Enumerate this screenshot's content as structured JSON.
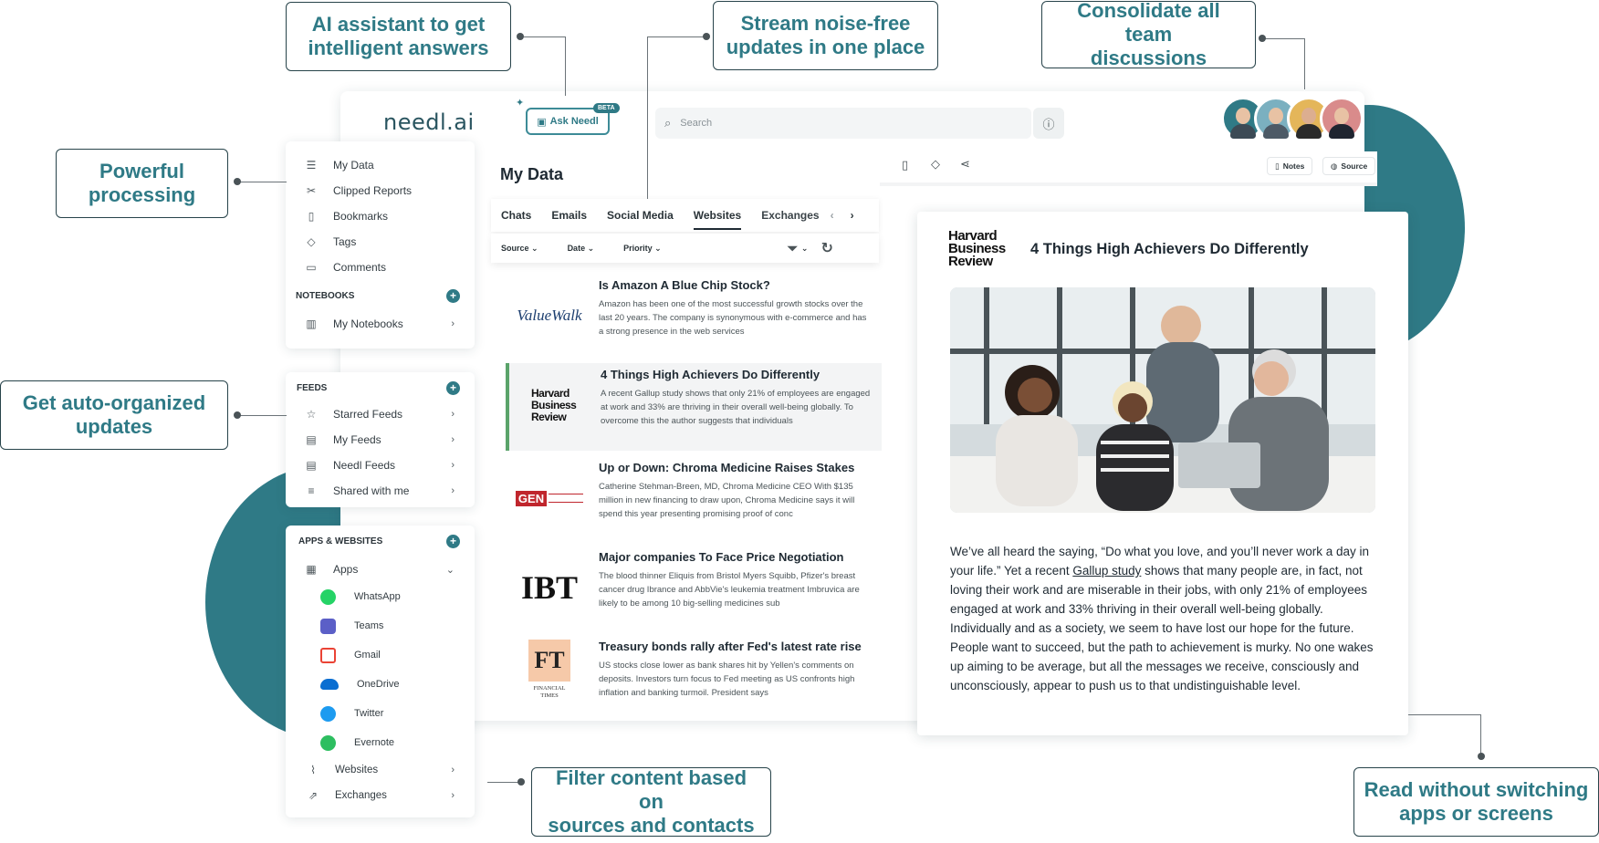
{
  "callouts": {
    "ai": "AI assistant to get\nintelligent answers",
    "stream": "Stream noise-free\nupdates in one place",
    "consolidate": "Consolidate all team\ndiscussions",
    "processing": "Powerful\nprocessing",
    "auto": "Get auto-organized\nupdates",
    "filter": "Filter content based on\nsources and contacts",
    "read": "Read without switching\napps or screens"
  },
  "header": {
    "logo": "needl.ai",
    "ask_label": "Ask Needl",
    "beta": "BETA",
    "search_placeholder": "Search"
  },
  "sidebar": {
    "main_items": [
      {
        "label": "My Data",
        "icon": "list-icon"
      },
      {
        "label": "Clipped Reports",
        "icon": "scissors-icon"
      },
      {
        "label": "Bookmarks",
        "icon": "bookmark-icon"
      },
      {
        "label": "Tags",
        "icon": "tag-icon"
      },
      {
        "label": "Comments",
        "icon": "comment-icon"
      }
    ],
    "notebooks_heading": "NOTEBOOKS",
    "notebooks_item": "My Notebooks",
    "feeds_heading": "FEEDS",
    "feeds": [
      "Starred Feeds",
      "My Feeds",
      "Needl Feeds",
      "Shared with me"
    ],
    "apps_heading": "APPS & WEBSITES",
    "apps_label": "Apps",
    "apps": [
      {
        "label": "WhatsApp",
        "color": "#25d366"
      },
      {
        "label": "Teams",
        "color": "#5b5fc7"
      },
      {
        "label": "Gmail",
        "color": "#ea4335"
      },
      {
        "label": "OneDrive",
        "color": "#0a6ed1"
      },
      {
        "label": "Twitter",
        "color": "#1d9bf0"
      },
      {
        "label": "Evernote",
        "color": "#2dbe60"
      }
    ],
    "websites": "Websites",
    "exchanges": "Exchanges"
  },
  "list": {
    "title": "My Data",
    "tabs": [
      "Chats",
      "Emails",
      "Social Media",
      "Websites",
      "Exchanges"
    ],
    "active_tab": "Websites",
    "filters": [
      "Source",
      "Date",
      "Priority"
    ],
    "articles": [
      {
        "source": "ValueWalk",
        "title": "Is Amazon A Blue Chip Stock?",
        "excerpt": "Amazon has been one of the most successful growth stocks over the last 20 years. The company is synonymous with e-commerce and has a strong presence in the web services"
      },
      {
        "source": "Harvard Business Review",
        "title": "4 Things High Achievers Do Differently",
        "excerpt": "A recent Gallup study shows that only 21% of employees are engaged at work and 33% are thriving in their overall well-being globally. To overcome this the author suggests that individuals"
      },
      {
        "source": "GEN",
        "title": "Up or Down: Chroma Medicine Raises Stakes",
        "excerpt": "Catherine Stehman-Breen, MD, Chroma Medicine CEO With $135 million in new financing to draw upon, Chroma Medicine says it will spend this year presenting promising proof of conc"
      },
      {
        "source": "IBT",
        "title": "Major companies To Face Price Negotiation",
        "excerpt": "The blood thinner Eliquis from Bristol Myers Squibb, Pfizer's breast cancer drug Ibrance and AbbVie's leukemia treatment Imbruvica are likely to be among 10 big-selling medicines sub"
      },
      {
        "source": "FT",
        "title": "Treasury bonds rally after Fed's latest rate rise",
        "excerpt": "US stocks close lower as bank shares hit by Yellen's comments on deposits. Investors turn focus to Fed meeting as US confronts high inflation and banking turmoil. President says"
      }
    ]
  },
  "reader": {
    "notes": "Notes",
    "source": "Source",
    "publisher_line1": "Harvard",
    "publisher_line2": "Business",
    "publisher_line3": "Review",
    "title": "4 Things High Achievers Do Differently",
    "body_a": "We’ve all heard the saying, “Do what you love, and you’ll never work a day in your life.” Yet a recent ",
    "body_link": "Gallup study",
    "body_b": " shows that many people are, in fact, not loving their work and are miserable in their jobs, with only 21% of employees engaged at work and 33% thriving in their overall well-being globally. Individually and as a society, we seem to have lost our hope for the future. People want to succeed, but the path to achievement is murky. No one wakes up aiming to be average, but all the messages we receive, consciously and unconsciously, appear to push us to that undistinguishable level."
  },
  "colors": {
    "accent": "#2f7a86",
    "selected_bar": "#5aa36a"
  }
}
